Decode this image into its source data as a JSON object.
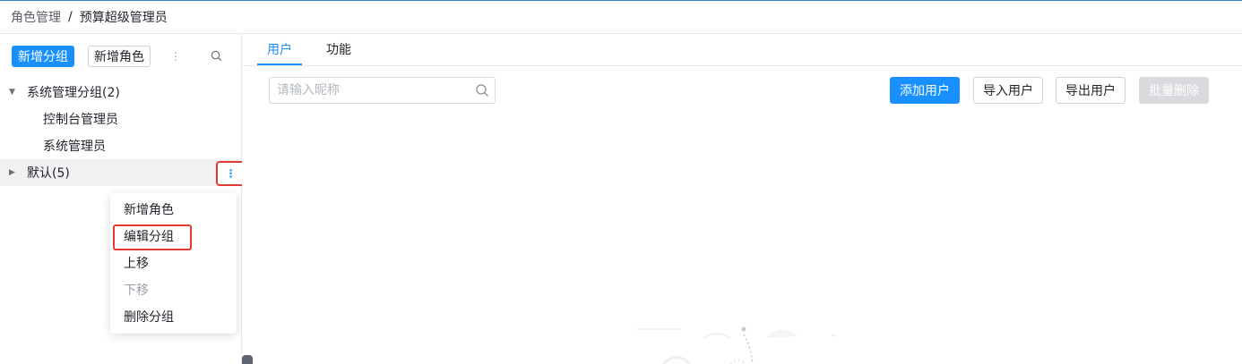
{
  "breadcrumb": {
    "parent": "角色管理",
    "separator": "/",
    "current": "预算超级管理员"
  },
  "left_toolbar": {
    "add_group": "新增分组",
    "add_role": "新增角色",
    "more_icon": "vertical-dots-icon",
    "search_icon": "search-icon"
  },
  "tree": {
    "groups": [
      {
        "label": "系统管理分组(2)",
        "expanded": true,
        "children": [
          "控制台管理员",
          "系统管理员"
        ]
      },
      {
        "label": "默认(5)",
        "expanded": false,
        "children": []
      }
    ]
  },
  "context_menu": {
    "items": [
      {
        "label": "新增角色",
        "disabled": false
      },
      {
        "label": "编辑分组",
        "disabled": false,
        "highlighted": true
      },
      {
        "label": "上移",
        "disabled": false
      },
      {
        "label": "下移",
        "disabled": true
      },
      {
        "label": "删除分组",
        "disabled": false
      }
    ]
  },
  "tabs": [
    {
      "label": "用户",
      "active": true
    },
    {
      "label": "功能",
      "active": false
    }
  ],
  "search": {
    "placeholder": "请输入昵称",
    "value": ""
  },
  "actions": {
    "add_user": "添加用户",
    "import_users": "导入用户",
    "export_users": "导出用户",
    "batch_delete": "批量删除"
  },
  "colors": {
    "accent": "#1890ff",
    "highlight_border": "#e53935",
    "disabled_button": "#d8dadd"
  }
}
